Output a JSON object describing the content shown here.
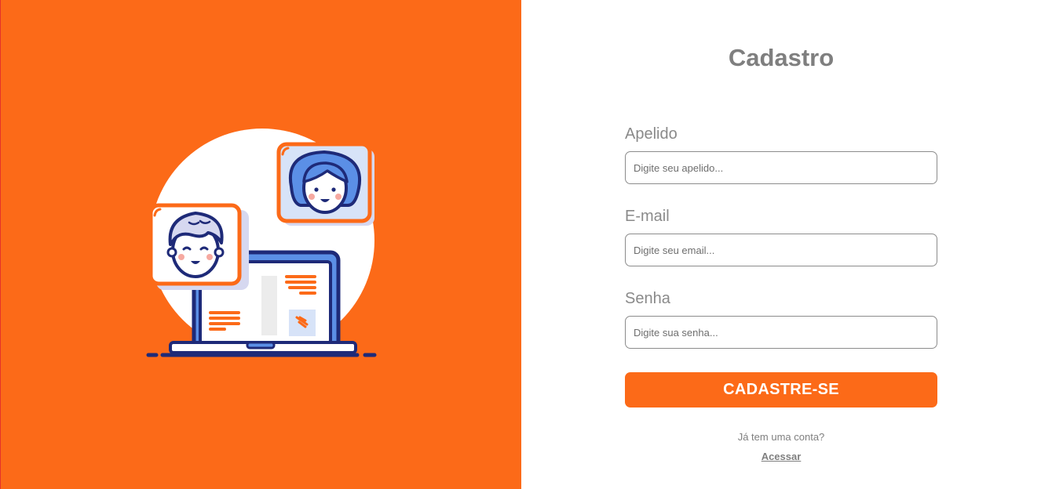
{
  "form": {
    "title": "Cadastro",
    "fields": [
      {
        "label": "Apelido",
        "placeholder": "Digite seu apelido...",
        "value": ""
      },
      {
        "label": "E-mail",
        "placeholder": "Digite seu email...",
        "value": ""
      },
      {
        "label": "Senha",
        "placeholder": "Digite sua senha...",
        "value": ""
      }
    ],
    "submit_label": "CADASTRE-SE",
    "account_question": "Já tem uma conta?",
    "login_link": "Acessar"
  },
  "colors": {
    "brand_orange": "#fc6a18",
    "text_gray": "#7f7f7f",
    "illustration_navy": "#1e2a78",
    "illustration_blue": "#5b8fe6",
    "illustration_lavender": "#d6d8f0"
  },
  "illustration": {
    "icons": [
      "laptop-icon",
      "male-avatar-icon",
      "female-avatar-icon"
    ]
  }
}
